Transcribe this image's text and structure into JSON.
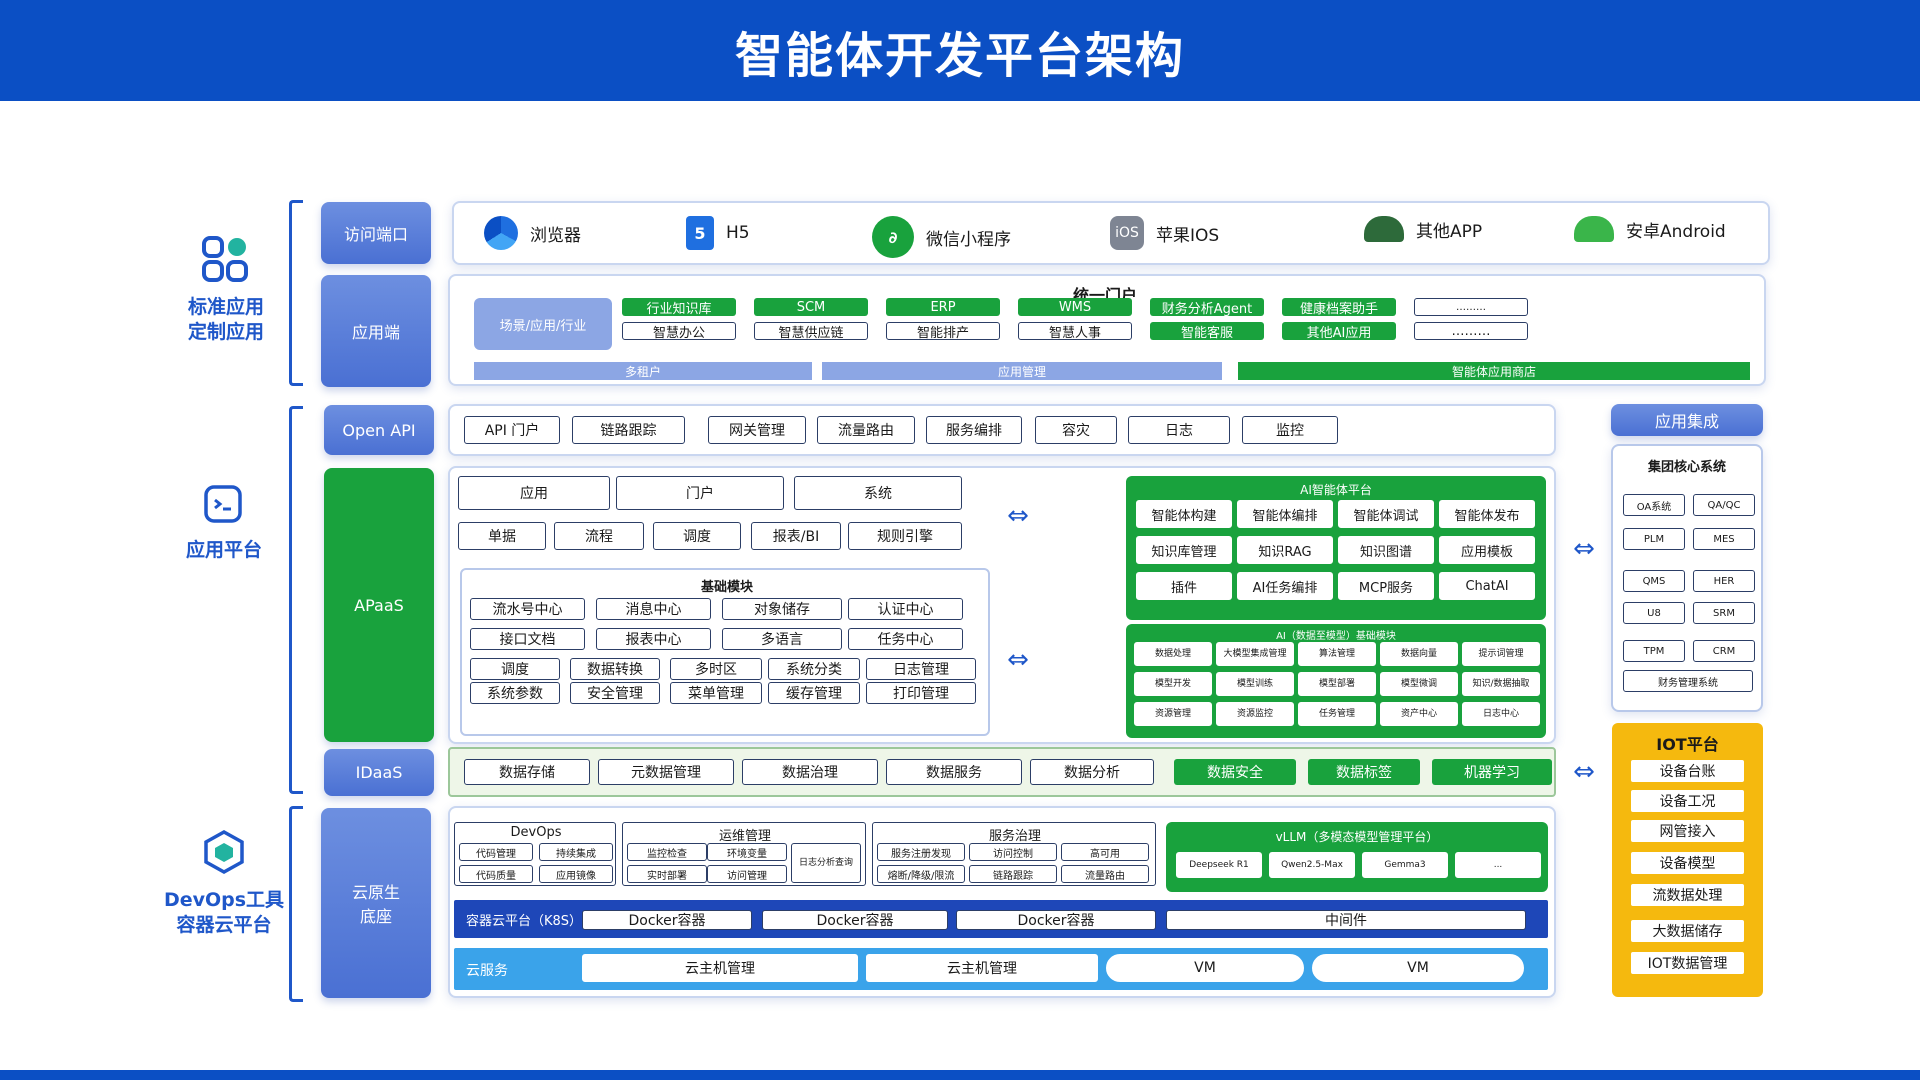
{
  "page_title": "智能体开发平台架构",
  "sections": {
    "standard": "标准应用\n定制应用",
    "platform": "应用平台",
    "devops": "DevOps工具\n容器云平台"
  },
  "rows": {
    "access": "访问端口",
    "app": "应用端",
    "openapi": "Open API",
    "apaas": "APaaS",
    "idaas": "IDaaS",
    "cloud": "云原生\n底座"
  },
  "clients": [
    "浏览器",
    "H5",
    "微信小程序",
    "苹果IOS",
    "其他APP",
    "安卓Android"
  ],
  "portal": {
    "title": "统一门户",
    "scene": "场景/应用/行业",
    "row1": [
      "行业知识库",
      "SCM",
      "ERP",
      "WMS",
      "财务分析Agent",
      "健康档案助手",
      "………"
    ],
    "row2": [
      "智慧办公",
      "智慧供应链",
      "智能排产",
      "智慧人事",
      "智能客服",
      "其他AI应用",
      "………"
    ],
    "strip": [
      "多租户",
      "应用管理",
      "智能体应用商店"
    ]
  },
  "openapi_items": [
    "API 门户",
    "链路跟踪",
    "网关管理",
    "流量路由",
    "服务编排",
    "容灾",
    "日志",
    "监控"
  ],
  "apaas": {
    "row1": [
      "应用",
      "门户",
      "系统"
    ],
    "row2": [
      "单据",
      "流程",
      "调度",
      "报表/BI",
      "规则引擎"
    ],
    "base_title": "基础模块",
    "base_rows": [
      [
        "流水号中心",
        "消息中心",
        "对象储存",
        "认证中心"
      ],
      [
        "接口文档",
        "报表中心",
        "多语言",
        "任务中心"
      ],
      [
        "调度",
        "数据转换",
        "多时区",
        "系统分类",
        "日志管理"
      ],
      [
        "系统参数",
        "安全管理",
        "菜单管理",
        "缓存管理",
        "打印管理"
      ]
    ],
    "ai_title": "AI智能体平台",
    "ai_rows": [
      [
        "智能体构建",
        "智能体编排",
        "智能体调试",
        "智能体发布"
      ],
      [
        "知识库管理",
        "知识RAG",
        "知识图谱",
        "应用模板"
      ],
      [
        "插件",
        "AI任务编排",
        "MCP服务",
        "ChatAI"
      ]
    ],
    "ai2_title": "AI（数据至模型）基础模块",
    "ai2_rows": [
      [
        "数据处理",
        "大模型集成管理",
        "算法管理",
        "数据向量",
        "提示词管理"
      ],
      [
        "模型开发",
        "模型训练",
        "模型部署",
        "模型微调",
        "知识/数据抽取"
      ],
      [
        "资源管理",
        "资源监控",
        "任务管理",
        "资产中心",
        "日志中心"
      ]
    ]
  },
  "idaas_items": [
    "数据存储",
    "元数据管理",
    "数据治理",
    "数据服务",
    "数据分析"
  ],
  "idaas_green": [
    "数据安全",
    "数据标签",
    "机器学习"
  ],
  "devops": {
    "title": "DevOps",
    "items": [
      "代码管理",
      "持续集成",
      "代码质量",
      "应用镜像"
    ],
    "ops_title": "运维管理",
    "ops_items": [
      "监控检查",
      "环境变量",
      "日志分析查询",
      "实时部署",
      "访问管理"
    ],
    "gov_title": "服务治理",
    "gov_items": [
      "服务注册发现",
      "访问控制",
      "高可用",
      "熔断/降级/限流",
      "链路跟踪",
      "流量路由"
    ],
    "vllm_title": "vLLM（多模态模型管理平台）",
    "vllm_items": [
      "Deepseek R1",
      "Qwen2.5-Max",
      "Gemma3",
      "..."
    ]
  },
  "k8s": {
    "label": "容器云平台（K8S）",
    "items": [
      "Docker容器",
      "Docker容器",
      "Docker容器",
      "中间件"
    ]
  },
  "cloudsvc": {
    "label": "云服务",
    "items": [
      "云主机管理",
      "云主机管理",
      "VM",
      "VM"
    ]
  },
  "integration": {
    "title": "应用集成",
    "core": "集团核心系统",
    "items": [
      "OA系统",
      "QA/QC",
      "PLM",
      "MES",
      "QMS",
      "HER",
      "U8",
      "SRM",
      "TPM",
      "CRM"
    ],
    "finance": "财务管理系统"
  },
  "iot": {
    "title": "IOT平台",
    "items": [
      "设备台账",
      "设备工况",
      "网管接入",
      "设备模型",
      "流数据处理",
      "大数据储存",
      "IOT数据管理"
    ]
  },
  "colors": {
    "brand": "#0b4fc4",
    "green": "#19a23d",
    "iot": "#f5b90e"
  },
  "arrow": "⇔"
}
